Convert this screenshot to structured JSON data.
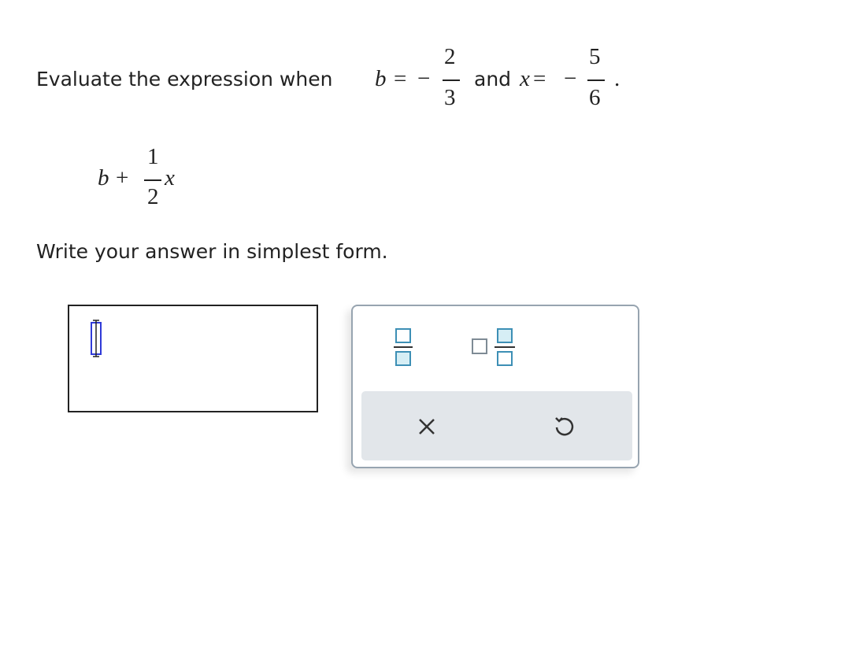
{
  "question": {
    "prompt_text": "Evaluate the expression when",
    "b_var": "b",
    "equals": "=",
    "minus": "−",
    "b_numerator": "2",
    "b_denominator": "3",
    "and_text": "and",
    "x_var": "x",
    "x_numerator": "5",
    "x_denominator": "6",
    "period": "."
  },
  "expression": {
    "var_b": "b",
    "plus": "+",
    "numerator": "1",
    "denominator": "2",
    "var_x": "x"
  },
  "instruction": "Write your answer in simplest form.",
  "answer": {
    "value": ""
  },
  "palette": {
    "buttons": [
      "fraction",
      "mixed-number",
      "clear",
      "undo"
    ],
    "icon_color": "#3d8fb5",
    "icon_fill": "#d6eef5"
  }
}
